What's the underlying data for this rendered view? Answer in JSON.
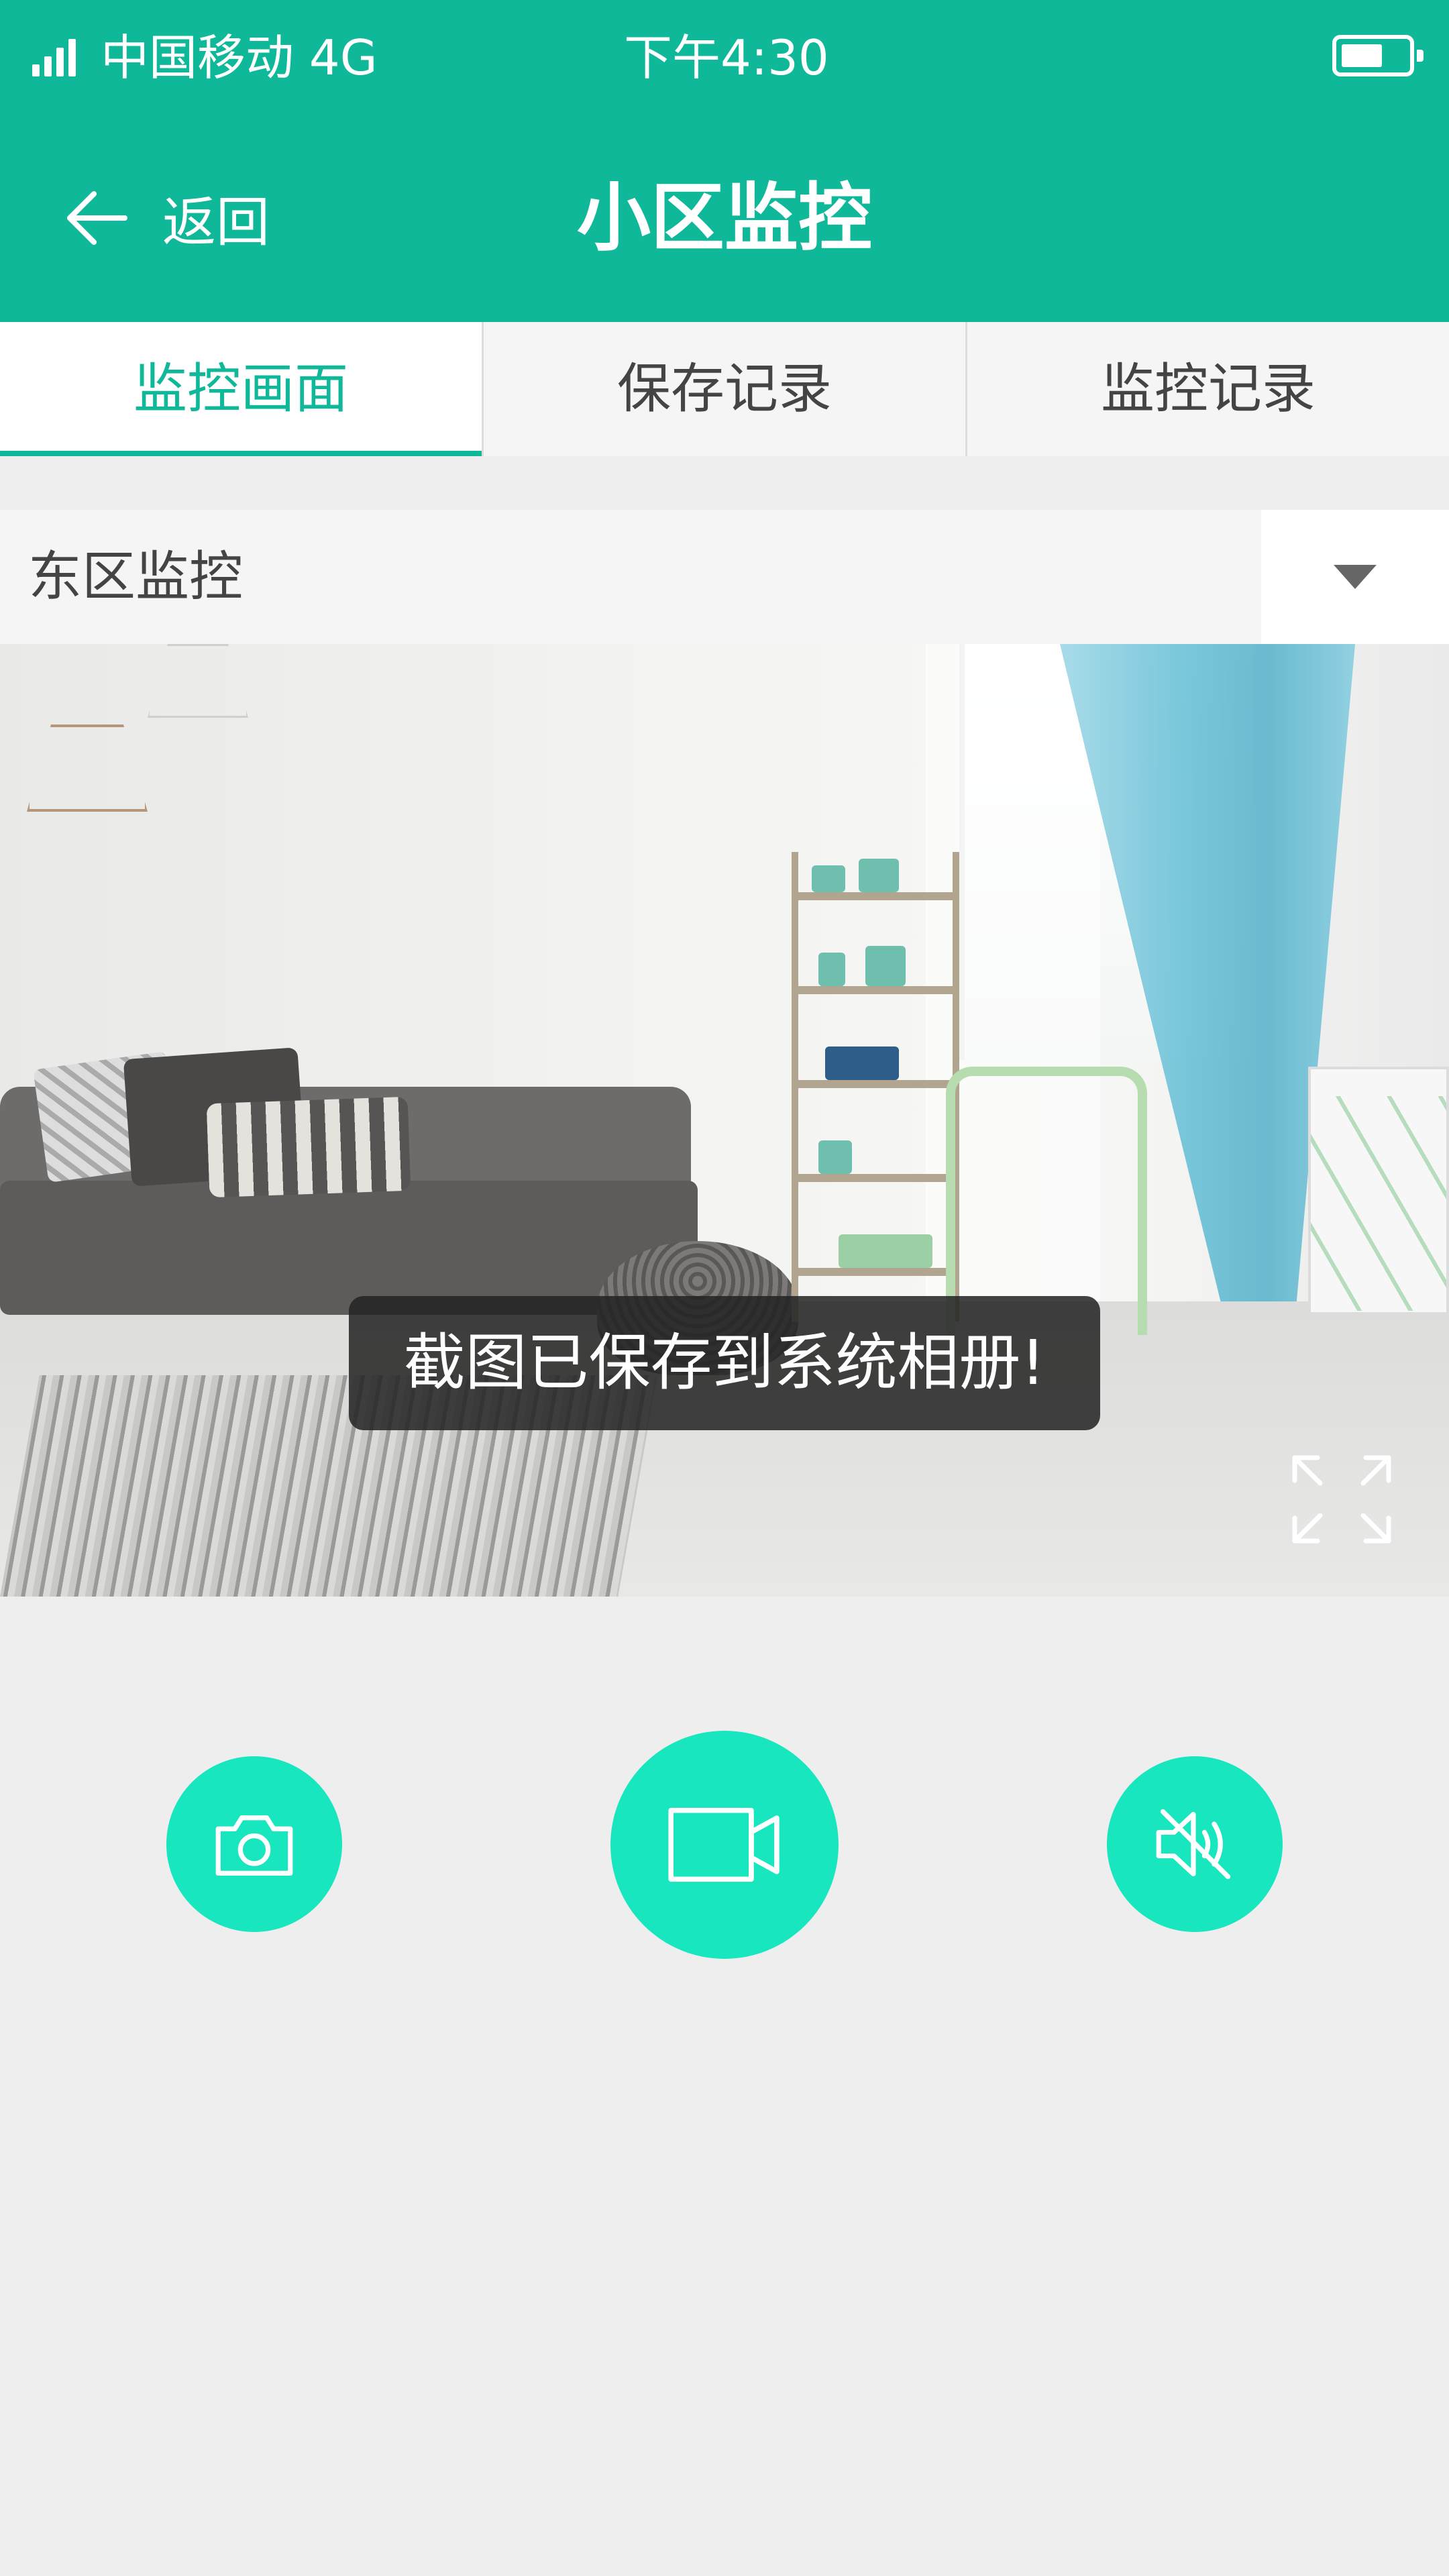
{
  "status_bar": {
    "carrier": "中国移动  4G",
    "time": "下午4:30",
    "signal_icon": "signal-bars-icon",
    "battery_icon": "battery-icon"
  },
  "header": {
    "back_label": "返回",
    "title": "小区监控"
  },
  "tabs": [
    {
      "label": "监控画面",
      "active": true
    },
    {
      "label": "保存记录",
      "active": false
    },
    {
      "label": "监控记录",
      "active": false
    }
  ],
  "camera_select": {
    "selected": "东区监控"
  },
  "video": {
    "toast": "截图已保存到系统相册!",
    "fullscreen_icon": "fullscreen-icon"
  },
  "controls": {
    "snapshot_icon": "camera-icon",
    "record_icon": "video-camera-icon",
    "mute_icon": "speaker-muted-icon"
  },
  "colors": {
    "brand": "#10b89a",
    "control_button": "#18e6be",
    "background": "#eeeeee"
  }
}
